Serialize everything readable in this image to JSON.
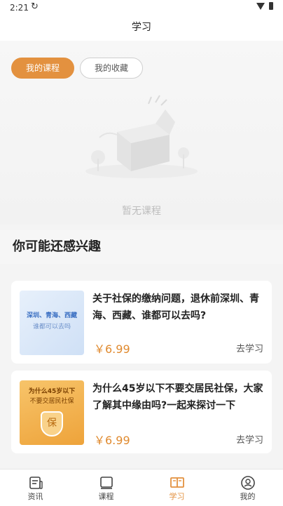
{
  "status_bar": {
    "time": "2:21"
  },
  "header": {
    "title": "学习"
  },
  "tabs": [
    {
      "label": "我的课程",
      "active": true
    },
    {
      "label": "我的收藏",
      "active": false
    }
  ],
  "empty_state": {
    "text": "暂无课程"
  },
  "recommend": {
    "title": "你可能还感兴趣",
    "courses": [
      {
        "title": "关于社保的缴纳问题，退休前深圳、青海、西藏、谁都可以去吗?",
        "price": "￥6.99",
        "action": "去学习",
        "thumb_lines": [
          "深圳、青海、西藏",
          "谁都可以去吗"
        ],
        "thumb_color": "#cfe0f6"
      },
      {
        "title": "为什么45岁以下不要交居民社保，大家了解其中缘由吗?一起来探讨一下",
        "price": "￥6.99",
        "action": "去学习",
        "thumb_lines": [
          "为什么45岁以下",
          "不要交居民社保",
          "保"
        ],
        "thumb_color": "#eea33a"
      }
    ]
  },
  "bottom_nav": [
    {
      "label": "资讯",
      "icon": "news-icon",
      "active": false
    },
    {
      "label": "课程",
      "icon": "book-icon",
      "active": false
    },
    {
      "label": "学习",
      "icon": "open-book-icon",
      "active": true
    },
    {
      "label": "我的",
      "icon": "profile-icon",
      "active": false
    }
  ],
  "colors": {
    "accent": "#e3913f",
    "price": "#e08a2f"
  }
}
